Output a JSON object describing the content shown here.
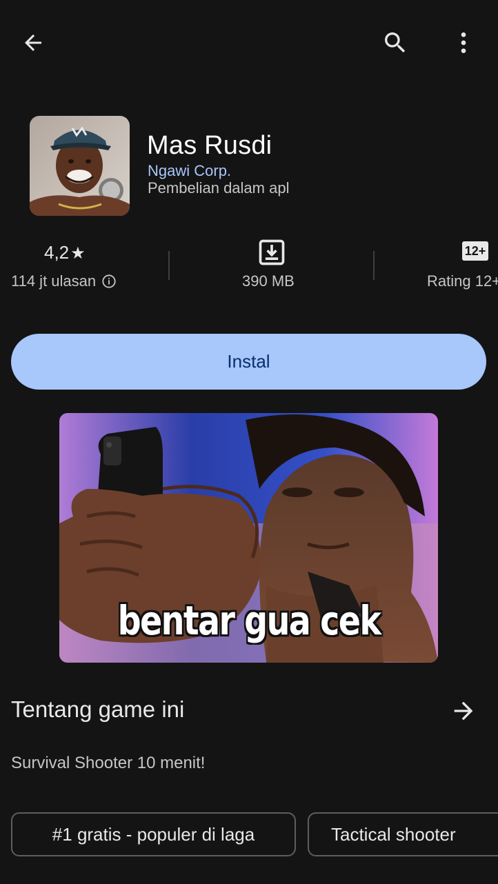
{
  "app": {
    "title": "Mas Rusdi",
    "developer": "Ngawi Corp.",
    "in_app_purchases": "Pembelian dalam apl"
  },
  "stats": {
    "rating_value": "4,2",
    "rating_star": "★",
    "reviews": "114 jt ulasan",
    "size": "390 MB",
    "age_badge": "12+",
    "age_rating": "Rating 12+"
  },
  "install": {
    "label": "Instal"
  },
  "screenshot": {
    "caption": "bentar gua cek"
  },
  "about": {
    "title": "Tentang game ini",
    "description": "Survival Shooter 10 menit!"
  },
  "chips": [
    {
      "label": "#1 gratis - populer di laga"
    },
    {
      "label": "Tactical shooter"
    }
  ],
  "colors": {
    "background": "#141414",
    "accent": "#a8c7fa",
    "accent_text": "#062e6f",
    "developer_link": "#a8c7fa"
  },
  "icons": {
    "back": "arrow-left",
    "search": "magnifier",
    "more": "vertical-dots",
    "info": "info-circle",
    "download": "download-box",
    "about_arrow": "arrow-right"
  }
}
